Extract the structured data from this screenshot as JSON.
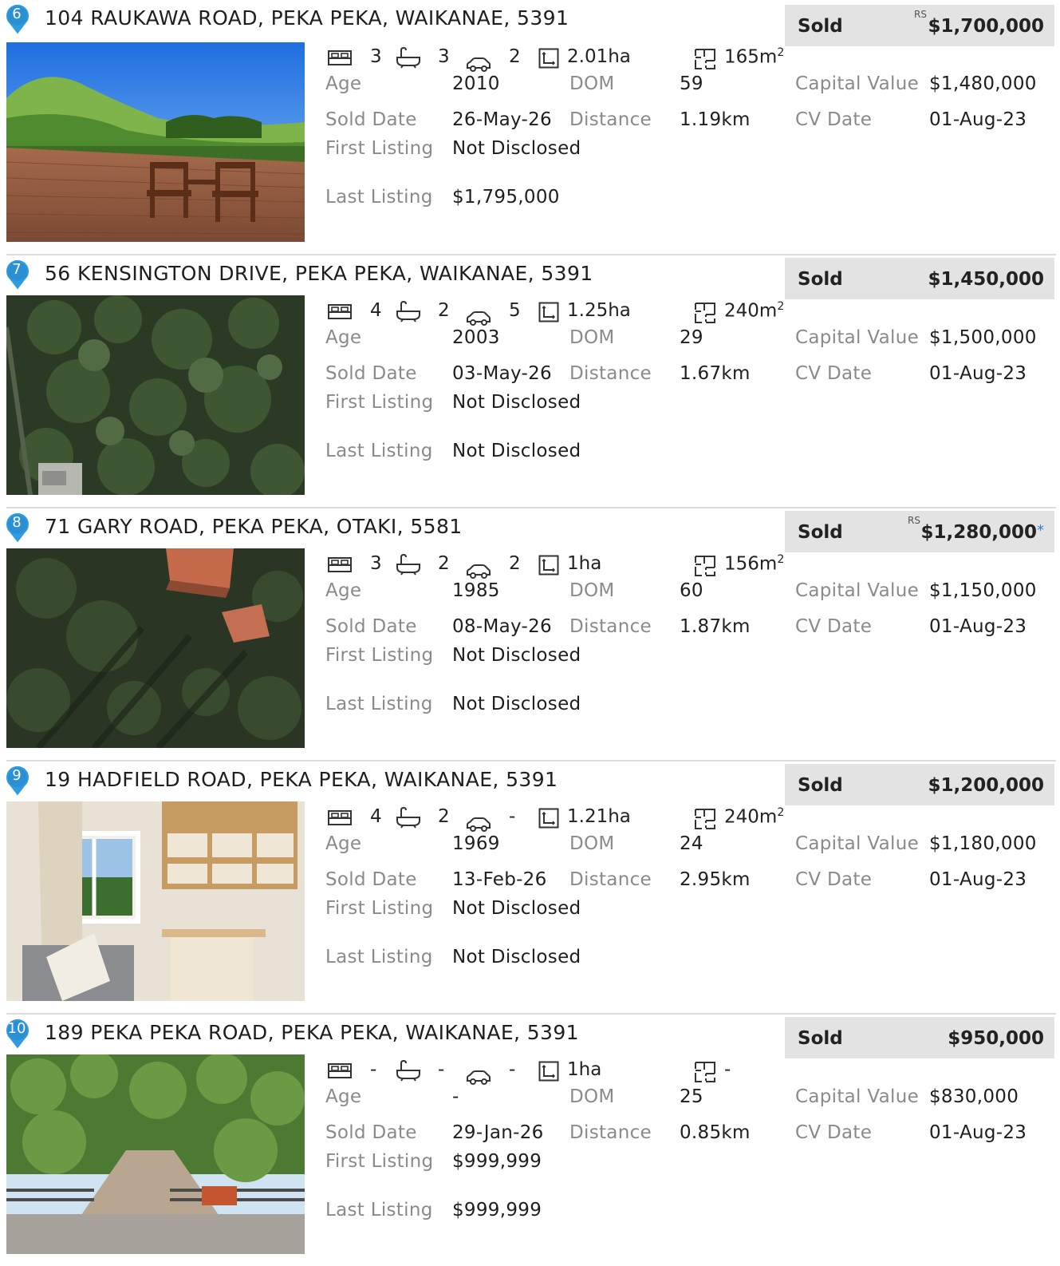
{
  "labels": {
    "age": "Age",
    "dom": "DOM",
    "capital_value": "Capital Value",
    "sold_date": "Sold Date",
    "distance": "Distance",
    "cv_date": "CV Date",
    "first_listing": "First Listing",
    "last_listing": "Last Listing",
    "status": "Sold",
    "rs": "RS",
    "area_unit_sup": "2"
  },
  "listings": [
    {
      "number": "6",
      "address": "104 RAUKAWA ROAD, PEKA PEKA, WAIKANAE, 5391",
      "price": "$1,700,000",
      "rs": true,
      "star": "",
      "beds": "3",
      "baths": "3",
      "cars": "2",
      "land": "2.01ha",
      "floor": "165m",
      "age": "2010",
      "dom": "59",
      "capital_value": "$1,480,000",
      "sold_date": "26-May-26",
      "distance": "1.19km",
      "cv_date": "01-Aug-23",
      "first_listing": "Not Disclosed",
      "last_listing": "$1,795,000",
      "photo": "deck-view"
    },
    {
      "number": "7",
      "address": "56 KENSINGTON DRIVE, PEKA PEKA, WAIKANAE, 5391",
      "price": "$1,450,000",
      "rs": false,
      "star": "",
      "beds": "4",
      "baths": "2",
      "cars": "5",
      "land": "1.25ha",
      "floor": "240m",
      "age": "2003",
      "dom": "29",
      "capital_value": "$1,500,000",
      "sold_date": "03-May-26",
      "distance": "1.67km",
      "cv_date": "01-Aug-23",
      "first_listing": "Not Disclosed",
      "last_listing": "Not Disclosed",
      "photo": "aerial-trees"
    },
    {
      "number": "8",
      "address": "71 GARY ROAD, PEKA PEKA, OTAKI, 5581",
      "price": "$1,280,000",
      "rs": true,
      "star": "*",
      "beds": "3",
      "baths": "2",
      "cars": "2",
      "land": "1ha",
      "floor": "156m",
      "age": "1985",
      "dom": "60",
      "capital_value": "$1,150,000",
      "sold_date": "08-May-26",
      "distance": "1.87km",
      "cv_date": "01-Aug-23",
      "first_listing": "Not Disclosed",
      "last_listing": "Not Disclosed",
      "photo": "aerial-roofs"
    },
    {
      "number": "9",
      "address": "19 HADFIELD ROAD, PEKA PEKA, WAIKANAE, 5391",
      "price": "$1,200,000",
      "rs": false,
      "star": "",
      "beds": "4",
      "baths": "2",
      "cars": "-",
      "land": "1.21ha",
      "floor": "240m",
      "age": "1969",
      "dom": "24",
      "capital_value": "$1,180,000",
      "sold_date": "13-Feb-26",
      "distance": "2.95km",
      "cv_date": "01-Aug-23",
      "first_listing": "Not Disclosed",
      "last_listing": "Not Disclosed",
      "photo": "interior-room"
    },
    {
      "number": "10",
      "address": "189 PEKA PEKA ROAD, PEKA PEKA, WAIKANAE, 5391",
      "price": "$950,000",
      "rs": false,
      "star": "",
      "beds": "-",
      "baths": "-",
      "cars": "-",
      "land": "1ha",
      "floor": "-",
      "age": "-",
      "dom": "25",
      "capital_value": "$830,000",
      "sold_date": "29-Jan-26",
      "distance": "0.85km",
      "cv_date": "01-Aug-23",
      "first_listing": "$999,999",
      "last_listing": "$999,999",
      "photo": "driveway"
    }
  ]
}
